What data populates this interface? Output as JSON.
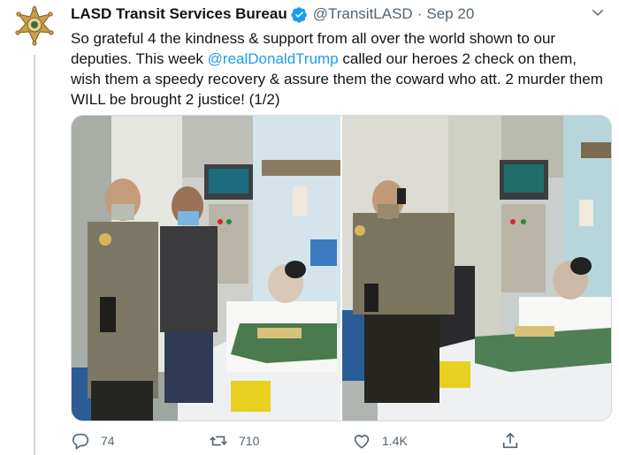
{
  "tweet": {
    "display_name": "LASD Transit Services Bureau",
    "handle": "@TransitLASD",
    "separator": "·",
    "date": "Sep 20",
    "text_before_mention": "So grateful 4 the kindness & support from all over the world shown to our deputies. This week ",
    "mention": "@realDonaldTrump",
    "text_after_mention": " called our heroes 2 check on them, wish them a speedy recovery & assure them the coward who att. 2 murder them WILL be brought 2 justice! (1/2)",
    "avatar_icon": "sheriff-star-badge-icon",
    "verified_icon": "verified-badge-icon",
    "more_icon": "chevron-down-icon"
  },
  "media": {
    "photos": [
      {
        "name": "hospital-photo-deputy-and-visitor"
      },
      {
        "name": "hospital-photo-deputy-on-phone"
      }
    ]
  },
  "actions": {
    "reply_count": "74",
    "retweet_count": "710",
    "like_count": "1.4K",
    "reply_icon": "reply-icon",
    "retweet_icon": "retweet-icon",
    "like_icon": "heart-icon",
    "share_icon": "share-icon"
  },
  "colors": {
    "link": "#1d9bf0",
    "verified": "#1d9bf0",
    "secondary_text": "#536471",
    "thread_line": "#cfd9de"
  }
}
